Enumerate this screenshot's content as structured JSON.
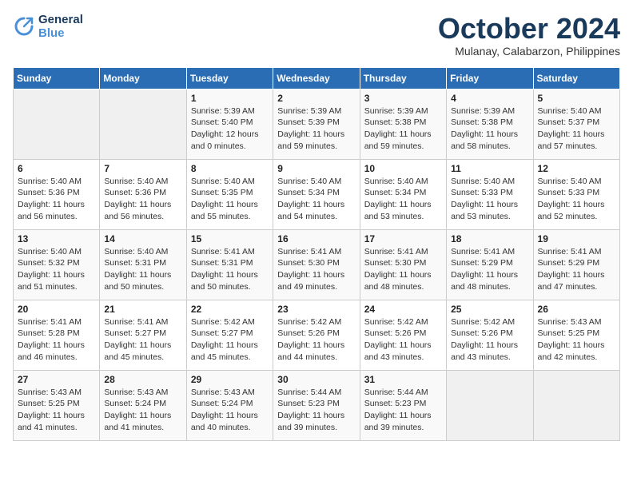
{
  "logo": {
    "line1": "General",
    "line2": "Blue"
  },
  "title": "October 2024",
  "subtitle": "Mulanay, Calabarzon, Philippines",
  "days_header": [
    "Sunday",
    "Monday",
    "Tuesday",
    "Wednesday",
    "Thursday",
    "Friday",
    "Saturday"
  ],
  "weeks": [
    [
      {
        "day": "",
        "info": ""
      },
      {
        "day": "",
        "info": ""
      },
      {
        "day": "1",
        "info": "Sunrise: 5:39 AM\nSunset: 5:40 PM\nDaylight: 12 hours and 0 minutes."
      },
      {
        "day": "2",
        "info": "Sunrise: 5:39 AM\nSunset: 5:39 PM\nDaylight: 11 hours and 59 minutes."
      },
      {
        "day": "3",
        "info": "Sunrise: 5:39 AM\nSunset: 5:38 PM\nDaylight: 11 hours and 59 minutes."
      },
      {
        "day": "4",
        "info": "Sunrise: 5:39 AM\nSunset: 5:38 PM\nDaylight: 11 hours and 58 minutes."
      },
      {
        "day": "5",
        "info": "Sunrise: 5:40 AM\nSunset: 5:37 PM\nDaylight: 11 hours and 57 minutes."
      }
    ],
    [
      {
        "day": "6",
        "info": "Sunrise: 5:40 AM\nSunset: 5:36 PM\nDaylight: 11 hours and 56 minutes."
      },
      {
        "day": "7",
        "info": "Sunrise: 5:40 AM\nSunset: 5:36 PM\nDaylight: 11 hours and 56 minutes."
      },
      {
        "day": "8",
        "info": "Sunrise: 5:40 AM\nSunset: 5:35 PM\nDaylight: 11 hours and 55 minutes."
      },
      {
        "day": "9",
        "info": "Sunrise: 5:40 AM\nSunset: 5:34 PM\nDaylight: 11 hours and 54 minutes."
      },
      {
        "day": "10",
        "info": "Sunrise: 5:40 AM\nSunset: 5:34 PM\nDaylight: 11 hours and 53 minutes."
      },
      {
        "day": "11",
        "info": "Sunrise: 5:40 AM\nSunset: 5:33 PM\nDaylight: 11 hours and 53 minutes."
      },
      {
        "day": "12",
        "info": "Sunrise: 5:40 AM\nSunset: 5:33 PM\nDaylight: 11 hours and 52 minutes."
      }
    ],
    [
      {
        "day": "13",
        "info": "Sunrise: 5:40 AM\nSunset: 5:32 PM\nDaylight: 11 hours and 51 minutes."
      },
      {
        "day": "14",
        "info": "Sunrise: 5:40 AM\nSunset: 5:31 PM\nDaylight: 11 hours and 50 minutes."
      },
      {
        "day": "15",
        "info": "Sunrise: 5:41 AM\nSunset: 5:31 PM\nDaylight: 11 hours and 50 minutes."
      },
      {
        "day": "16",
        "info": "Sunrise: 5:41 AM\nSunset: 5:30 PM\nDaylight: 11 hours and 49 minutes."
      },
      {
        "day": "17",
        "info": "Sunrise: 5:41 AM\nSunset: 5:30 PM\nDaylight: 11 hours and 48 minutes."
      },
      {
        "day": "18",
        "info": "Sunrise: 5:41 AM\nSunset: 5:29 PM\nDaylight: 11 hours and 48 minutes."
      },
      {
        "day": "19",
        "info": "Sunrise: 5:41 AM\nSunset: 5:29 PM\nDaylight: 11 hours and 47 minutes."
      }
    ],
    [
      {
        "day": "20",
        "info": "Sunrise: 5:41 AM\nSunset: 5:28 PM\nDaylight: 11 hours and 46 minutes."
      },
      {
        "day": "21",
        "info": "Sunrise: 5:41 AM\nSunset: 5:27 PM\nDaylight: 11 hours and 45 minutes."
      },
      {
        "day": "22",
        "info": "Sunrise: 5:42 AM\nSunset: 5:27 PM\nDaylight: 11 hours and 45 minutes."
      },
      {
        "day": "23",
        "info": "Sunrise: 5:42 AM\nSunset: 5:26 PM\nDaylight: 11 hours and 44 minutes."
      },
      {
        "day": "24",
        "info": "Sunrise: 5:42 AM\nSunset: 5:26 PM\nDaylight: 11 hours and 43 minutes."
      },
      {
        "day": "25",
        "info": "Sunrise: 5:42 AM\nSunset: 5:26 PM\nDaylight: 11 hours and 43 minutes."
      },
      {
        "day": "26",
        "info": "Sunrise: 5:43 AM\nSunset: 5:25 PM\nDaylight: 11 hours and 42 minutes."
      }
    ],
    [
      {
        "day": "27",
        "info": "Sunrise: 5:43 AM\nSunset: 5:25 PM\nDaylight: 11 hours and 41 minutes."
      },
      {
        "day": "28",
        "info": "Sunrise: 5:43 AM\nSunset: 5:24 PM\nDaylight: 11 hours and 41 minutes."
      },
      {
        "day": "29",
        "info": "Sunrise: 5:43 AM\nSunset: 5:24 PM\nDaylight: 11 hours and 40 minutes."
      },
      {
        "day": "30",
        "info": "Sunrise: 5:44 AM\nSunset: 5:23 PM\nDaylight: 11 hours and 39 minutes."
      },
      {
        "day": "31",
        "info": "Sunrise: 5:44 AM\nSunset: 5:23 PM\nDaylight: 11 hours and 39 minutes."
      },
      {
        "day": "",
        "info": ""
      },
      {
        "day": "",
        "info": ""
      }
    ]
  ]
}
